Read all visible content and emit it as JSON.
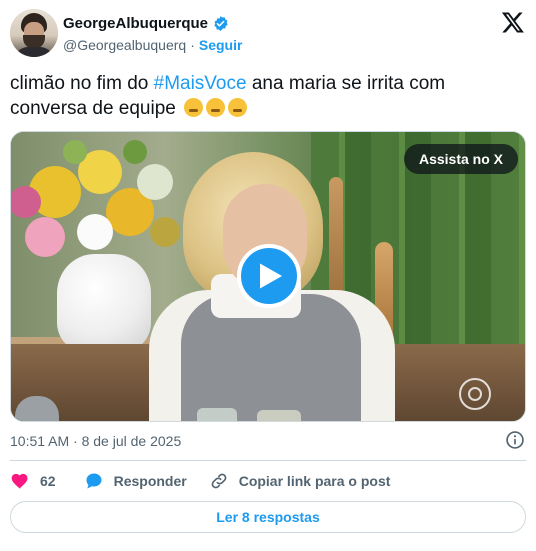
{
  "author": {
    "display_name": "GeorgeAlbuquerque",
    "handle": "@Georgealbuquerq",
    "separator": "·",
    "follow_label": "Seguir"
  },
  "tweet": {
    "text_before": "climão no fim do ",
    "hashtag": "#MaisVoce",
    "text_after": " ana maria se irrita com conversa de equipe"
  },
  "media": {
    "watch_label": "Assista no X"
  },
  "meta": {
    "timestamp": "10:51 AM · 8 de jul de 2025"
  },
  "actions": {
    "like_count": "62",
    "reply_label": "Responder",
    "copy_link_label": "Copiar link para o post"
  },
  "footer": {
    "read_replies_label": "Ler 8 respostas"
  },
  "colors": {
    "accent": "#1d9bf0",
    "like": "#f91880",
    "text": "#0f1419",
    "muted": "#536471",
    "border": "#cfd9de"
  },
  "icons": [
    "verified-badge-icon",
    "x-logo-icon",
    "play-icon",
    "info-icon",
    "heart-icon",
    "reply-bubble-icon",
    "link-icon"
  ]
}
